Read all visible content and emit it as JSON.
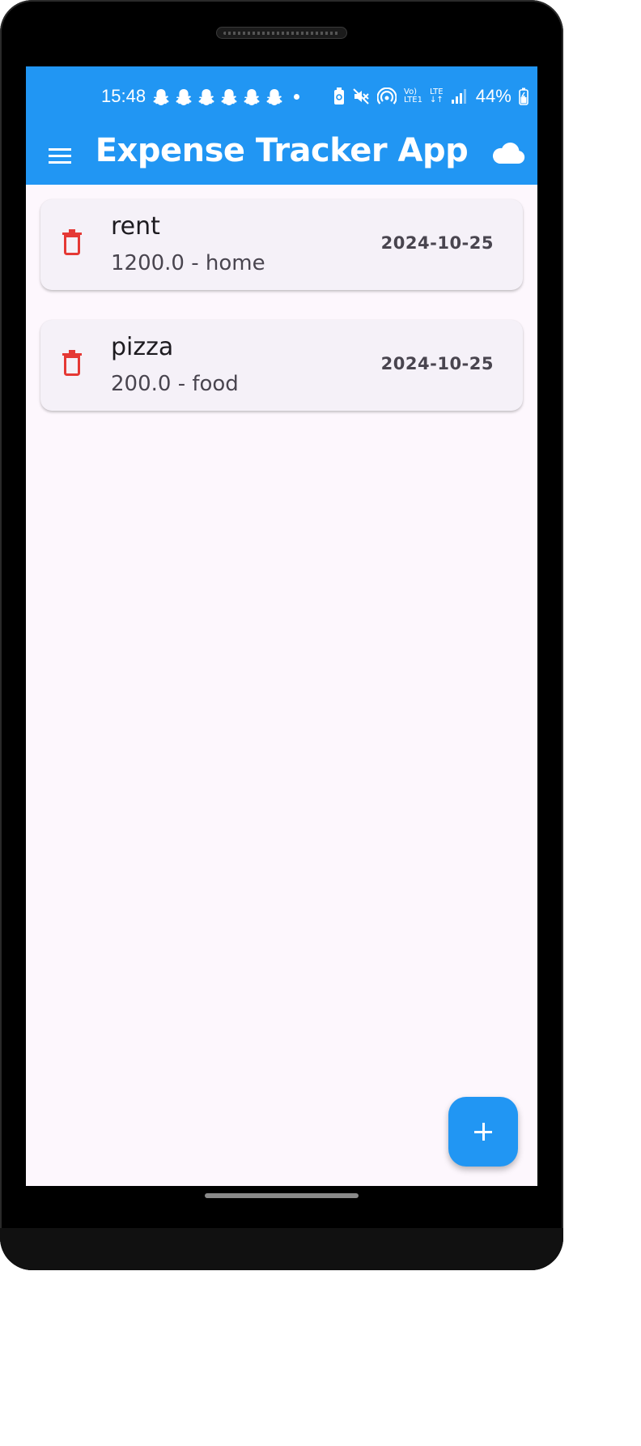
{
  "status_bar": {
    "time": "15:48",
    "notification_icons": [
      "snapchat-icon",
      "snapchat-icon",
      "snapchat-icon",
      "snapchat-icon",
      "snapchat-icon",
      "snapchat-icon"
    ],
    "network_top": "Vo)",
    "network_bottom": "LTE1",
    "lte_label": "LTE",
    "battery": "44%"
  },
  "app_bar": {
    "title": "Expense Tracker App",
    "color": "#2196f3",
    "menu_icon": "menu-icon",
    "cloud_icon": "cloud-icon"
  },
  "expenses": [
    {
      "title": "rent",
      "subtitle": "1200.0 - home",
      "date": "2024-10-25"
    },
    {
      "title": "pizza",
      "subtitle": "200.0 - food",
      "date": "2024-10-25"
    }
  ],
  "colors": {
    "delete": "#e53935",
    "background": "#fdf7fd",
    "card": "#f5f1f8"
  },
  "fab": {
    "icon": "add-icon"
  }
}
